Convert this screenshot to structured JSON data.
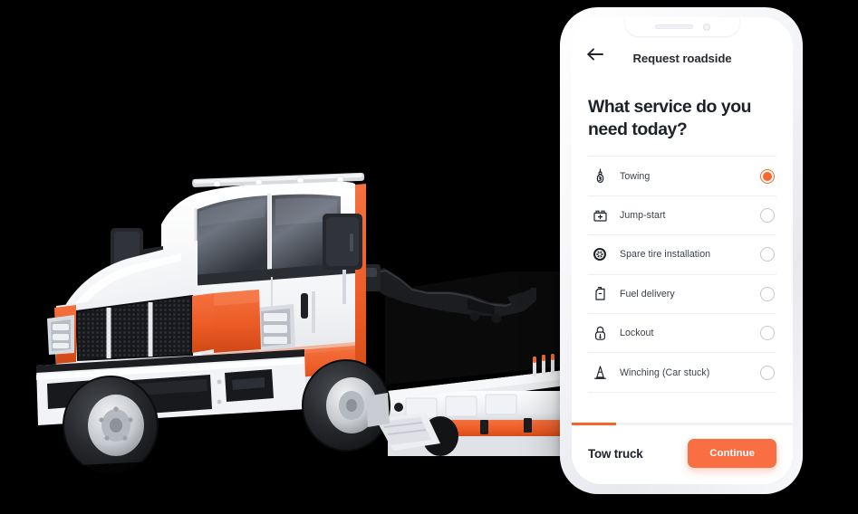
{
  "app": {
    "header": {
      "title": "Request roadside",
      "back_icon": "arrow-left-icon"
    },
    "question": "What service do you need today?",
    "services": [
      {
        "label": "Towing",
        "icon": "tow-hook-icon",
        "selected": true
      },
      {
        "label": "Jump-start",
        "icon": "car-battery-icon",
        "selected": false
      },
      {
        "label": "Spare tire installation",
        "icon": "tire-wheel-icon",
        "selected": false
      },
      {
        "label": "Fuel delivery",
        "icon": "fuel-can-icon",
        "selected": false
      },
      {
        "label": "Lockout",
        "icon": "padlock-icon",
        "selected": false
      },
      {
        "label": "Winching (Car stuck)",
        "icon": "traffic-cone-icon",
        "selected": false
      }
    ],
    "footer": {
      "vehicle_label": "Tow truck",
      "continue_label": "Continue",
      "progress_percent": 20
    }
  },
  "scene": {
    "background_color": "#000000",
    "vehicle": "white and orange flatbed tow truck"
  },
  "colors": {
    "accent_orange": "#f96e42",
    "radio_fill": "#f96428",
    "text_dark": "#1d222a",
    "text_muted": "#3b414b",
    "divider": "#eeeff2",
    "phone_body": "#f2f3f7"
  }
}
